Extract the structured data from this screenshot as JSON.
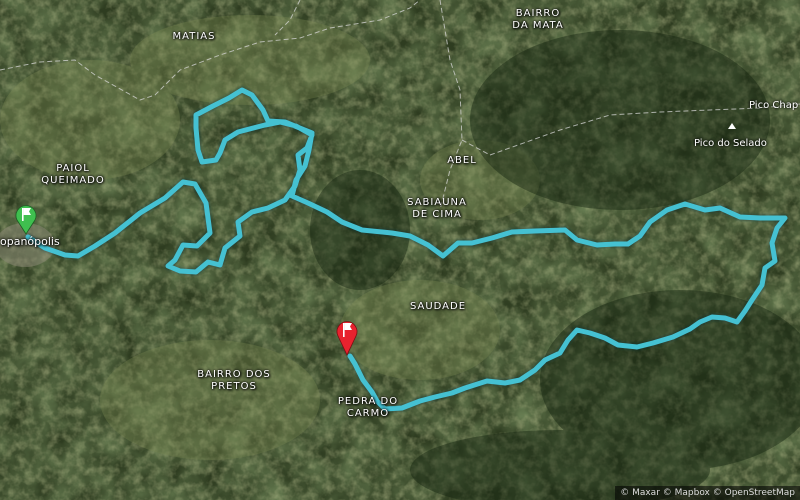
{
  "map": {
    "places": [
      {
        "id": "matias",
        "label": "MATIAS"
      },
      {
        "id": "bairro-da-mata",
        "label": "BAIRRO\nDA MATA"
      },
      {
        "id": "paiol-queimado",
        "label": "PAIOL\nQUEIMADO"
      },
      {
        "id": "abel",
        "label": "ABEL"
      },
      {
        "id": "sabiauna-de-cima",
        "label": "SABIAUNA\nDE CIMA"
      },
      {
        "id": "saudade",
        "label": "SAUDADE"
      },
      {
        "id": "bairro-dos-pretos",
        "label": "BAIRRO DOS\nPRETOS"
      },
      {
        "id": "pedra-do-carmo",
        "label": "PEDRA DO\nCARMO"
      },
      {
        "id": "town-left",
        "label": "opanópolis"
      }
    ],
    "peaks": [
      {
        "id": "pico-do-selado",
        "label": "Pico do Selado"
      },
      {
        "id": "pico-chapeu",
        "label": "Pico Chap"
      }
    ],
    "route_color": "#45c1d2",
    "start_marker": {
      "color": "#3fbf4f",
      "icon": "flag-icon"
    },
    "end_marker": {
      "color": "#e8222e",
      "icon": "flag-icon"
    },
    "attribution": "© Maxar © Mapbox © OpenStreetMap"
  }
}
